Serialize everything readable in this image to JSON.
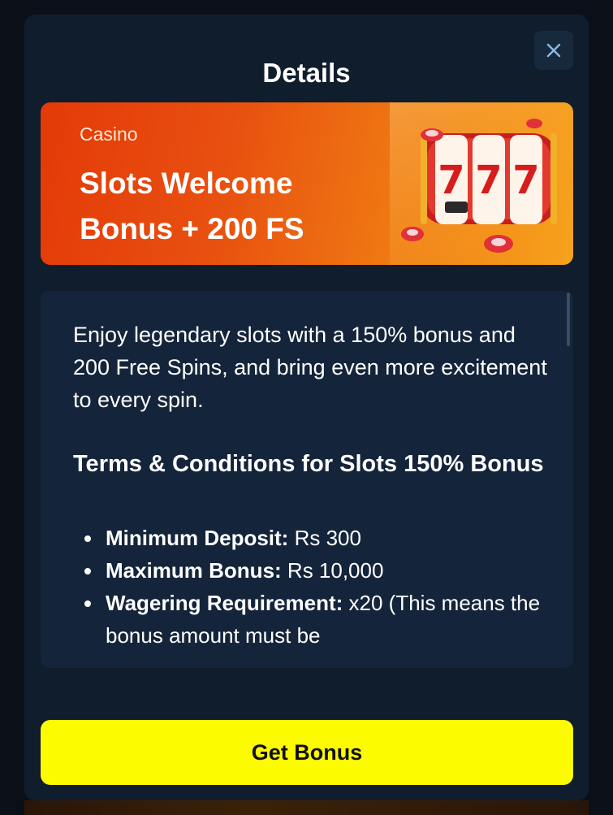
{
  "modal": {
    "title": "Details",
    "close_icon": "close-icon"
  },
  "banner": {
    "overline": "Casino",
    "title": "Slots Welcome Bonus + 200 FS",
    "art": "slot-machine-777-illustration"
  },
  "content": {
    "intro": "Enjoy legendary slots with a 150% bonus and 200 Free Spins, and bring even more excitement to every spin.",
    "terms_title": "Terms & Conditions for Slots 150% Bonus",
    "terms": [
      {
        "label": "Minimum Deposit:",
        "value": " Rs 300"
      },
      {
        "label": "Maximum Bonus:",
        "value": " Rs 10,000"
      },
      {
        "label": "Wagering Requirement:",
        "value": " x20 (This means the bonus amount must be"
      }
    ]
  },
  "actions": {
    "get_bonus_label": "Get Bonus"
  },
  "colors": {
    "modal_bg": "#0f1d2c",
    "content_bg": "#14243a",
    "button_bg": "#fdfb00",
    "banner_from": "#e43a08",
    "banner_to": "#f7a21c"
  }
}
